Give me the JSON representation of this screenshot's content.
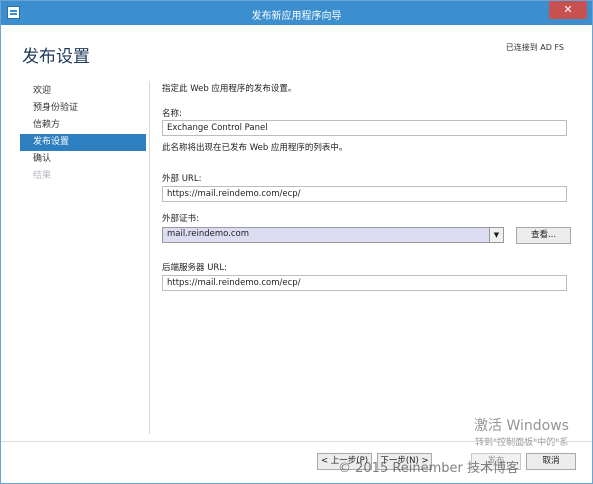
{
  "window": {
    "title": "发布新应用程序向导",
    "close_label": "✕"
  },
  "header": {
    "page_title": "发布设置",
    "connected_status": "已连接到 AD FS"
  },
  "sidebar": {
    "items": [
      {
        "label": "欢迎",
        "state": "normal"
      },
      {
        "label": "预身份验证",
        "state": "normal"
      },
      {
        "label": "信赖方",
        "state": "normal"
      },
      {
        "label": "发布设置",
        "state": "active"
      },
      {
        "label": "确认",
        "state": "normal"
      },
      {
        "label": "结果",
        "state": "disabled"
      }
    ]
  },
  "main": {
    "instruction": "指定此 Web 应用程序的发布设置。",
    "name_label": "名称:",
    "name_value": "Exchange Control Panel",
    "name_hint": "此名称将出现在已发布 Web 应用程序的列表中。",
    "external_url_label": "外部 URL:",
    "external_url_value": "https://mail.reindemo.com/ecp/",
    "cert_label": "外部证书:",
    "cert_value": "mail.reindemo.com",
    "view_button": "查看...",
    "backend_url_label": "后端服务器 URL:",
    "backend_url_value": "https://mail.reindemo.com/ecp/"
  },
  "footer": {
    "prev": "< 上一步(P)",
    "next": "下一步(N) >",
    "publish": "发布",
    "cancel": "取消"
  },
  "overlay": {
    "activate_title": "激活 Windows",
    "activate_hint": "转到\"控制面板\"中的\"系",
    "copyright": "© 2015 Reinember 技术博客"
  },
  "colors": {
    "titlebar": "#3c8fcf",
    "active_nav": "#2e7fc0",
    "close_button": "#c75050",
    "select_highlight": "#dcdcf2"
  }
}
